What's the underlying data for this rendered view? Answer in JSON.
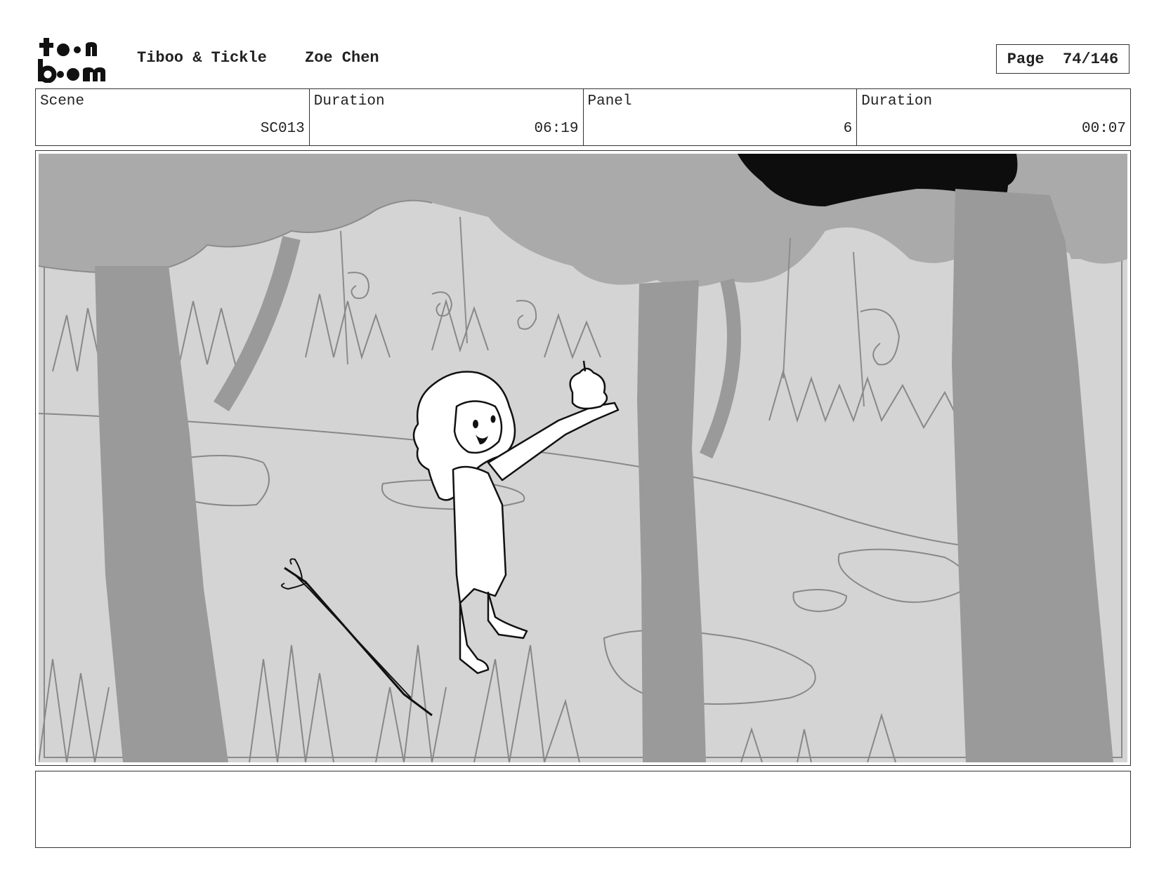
{
  "header": {
    "logo": {
      "top_text": "toon",
      "bottom_text": "boom",
      "icon": "toonboom-logo"
    },
    "project": "Tiboo & Tickle",
    "author": "Zoe Chen",
    "page": {
      "label": "Page",
      "value": "74/146"
    }
  },
  "meta": [
    {
      "label": "Scene",
      "value": "SC013"
    },
    {
      "label": "Duration",
      "value": "06:19"
    },
    {
      "label": "Panel",
      "value": "6"
    },
    {
      "label": "Duration",
      "value": "00:07"
    }
  ],
  "panel": {
    "illustration": "storyboard-sketch-forest-girl-holding-pear",
    "colors": {
      "background": "#d4d4d4",
      "mid": "#a9a9a9",
      "line": "#7a7a7a",
      "ink": "#111111"
    }
  },
  "notes": {
    "text": ""
  }
}
